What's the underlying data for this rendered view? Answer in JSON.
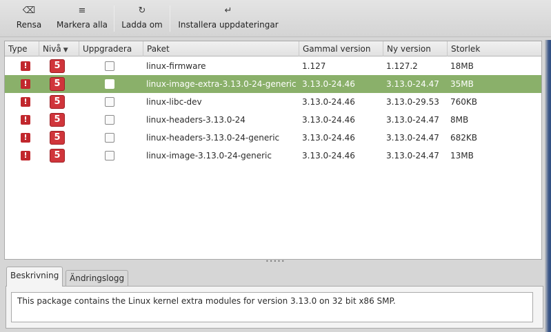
{
  "toolbar": {
    "clear_label": "Rensa",
    "select_all_label": "Markera alla",
    "reload_label": "Ladda om",
    "install_label": "Installera uppdateringar",
    "clear_icon": "⌫",
    "select_all_icon": "≡",
    "reload_icon": "↻",
    "install_icon": "↵"
  },
  "table": {
    "columns": [
      "Type",
      "Nivå",
      "Uppgradera",
      "Paket",
      "Gammal version",
      "Ny version",
      "Storlek"
    ],
    "sort_indicator": "▼",
    "type_symbol": "!",
    "rows": [
      {
        "level": "5",
        "package": "linux-firmware",
        "old_version": "1.127",
        "new_version": "1.127.2",
        "size": "18MB",
        "checked": false,
        "selected": false
      },
      {
        "level": "5",
        "package": "linux-image-extra-3.13.0-24-generic",
        "old_version": "3.13.0-24.46",
        "new_version": "3.13.0-24.47",
        "size": "35MB",
        "checked": false,
        "selected": true
      },
      {
        "level": "5",
        "package": "linux-libc-dev",
        "old_version": "3.13.0-24.46",
        "new_version": "3.13.0-29.53",
        "size": "760KB",
        "checked": false,
        "selected": false
      },
      {
        "level": "5",
        "package": "linux-headers-3.13.0-24",
        "old_version": "3.13.0-24.46",
        "new_version": "3.13.0-24.47",
        "size": "8MB",
        "checked": false,
        "selected": false
      },
      {
        "level": "5",
        "package": "linux-headers-3.13.0-24-generic",
        "old_version": "3.13.0-24.46",
        "new_version": "3.13.0-24.47",
        "size": "682KB",
        "checked": false,
        "selected": false
      },
      {
        "level": "5",
        "package": "linux-image-3.13.0-24-generic",
        "old_version": "3.13.0-24.46",
        "new_version": "3.13.0-24.47",
        "size": "13MB",
        "checked": false,
        "selected": false
      }
    ]
  },
  "panel": {
    "tabs": [
      "Beskrivning",
      "Ändringslogg"
    ],
    "description": "This package contains the Linux kernel extra modules for version 3.13.0 on 32 bit x86 SMP."
  },
  "colors": {
    "selected_row": "#8ab06a",
    "level_badge": "#d0353b",
    "type_icon": "#c1272d"
  }
}
